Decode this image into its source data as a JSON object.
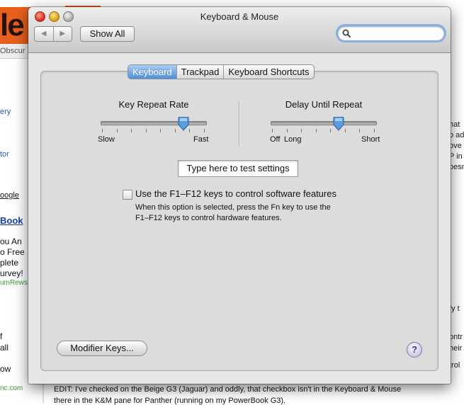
{
  "background": {
    "logo_text": "le",
    "topbar_text": "Obscur",
    "sidebar_links": [
      "ery",
      "tor"
    ],
    "google_link": "oogle",
    "book_link": "Book",
    "promo_lines": [
      "ou An",
      "o Free",
      "plete",
      "urvey!"
    ],
    "promo_source": "umRews",
    "side_words": [
      "f",
      "all",
      "ow"
    ],
    "footer_link": "nc.com",
    "right_col": [
      "hat",
      "o ad",
      "ove",
      "P in",
      "oesn",
      "fy t",
      "ontr",
      "heir",
      "trol"
    ],
    "bottom_lines": [
      "EDIT: I've checked on the Beige G3 (Jaguar) and oddly, that checkbox isn't in the Keyboard & Mouse",
      "there in the K&M pane for Panther (running on my PowerBook G3)."
    ]
  },
  "window": {
    "title": "Keyboard & Mouse",
    "nav_back": "◀",
    "nav_forward": "▶",
    "show_all": "Show All",
    "search_placeholder": ""
  },
  "tabs": [
    {
      "label": "Keyboard",
      "active": true
    },
    {
      "label": "Trackpad",
      "active": false
    },
    {
      "label": "Keyboard Shortcuts",
      "active": false
    }
  ],
  "key_repeat": {
    "label": "Key Repeat Rate",
    "min_label": "Slow",
    "max_label": "Fast",
    "value_fraction": 0.79
  },
  "delay_repeat": {
    "label": "Delay Until Repeat",
    "off_label": "Off",
    "min_label": "Long",
    "max_label": "Short",
    "value_fraction": 0.65
  },
  "test_field": {
    "placeholder": "Type here to test settings"
  },
  "fn_keys": {
    "checked": false,
    "label": "Use the F1–F12 keys to control software features",
    "description_line1": "When this option is selected, press the Fn key to use the",
    "description_line2": "F1–F12 keys to control hardware features."
  },
  "modifier_button": "Modifier Keys...",
  "help_button": "?"
}
